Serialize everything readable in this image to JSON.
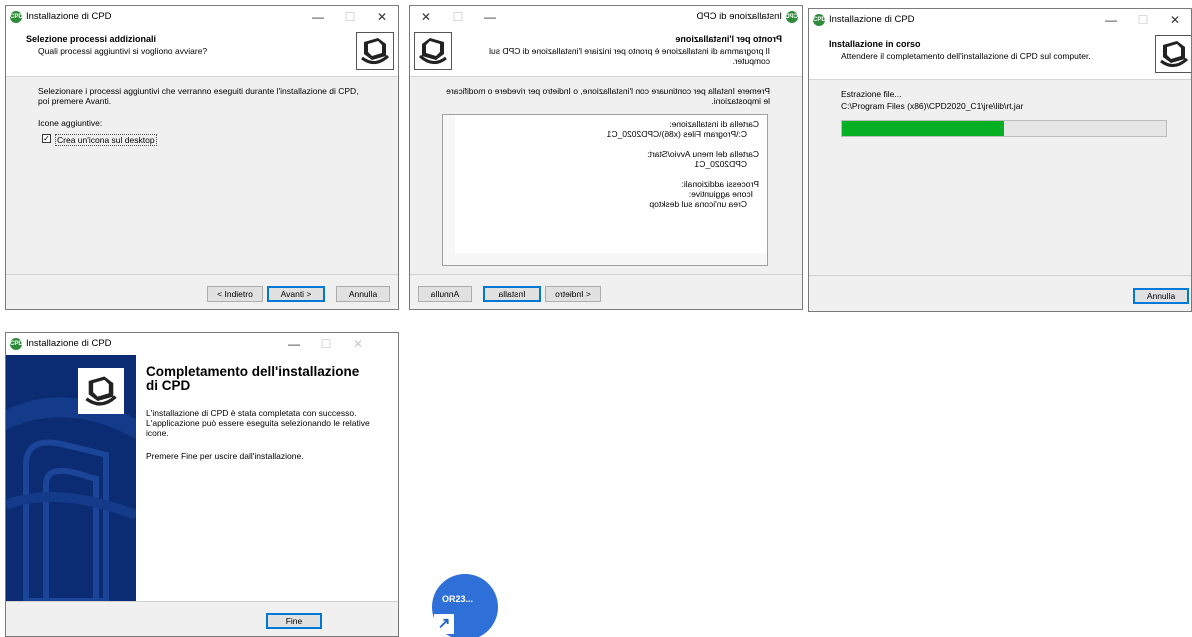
{
  "app_icon_text": "CPD",
  "window_title": "Installazione di CPD",
  "minimize": "—",
  "maximize": "☐",
  "close": "✕",
  "w1": {
    "header_title": "Selezione processi addizionali",
    "header_subtitle": "Quali processi aggiuntivi si vogliono avviare?",
    "instruction_line1": "Selezionare i processi aggiuntivi che verranno eseguiti durante l'installazione di CPD,",
    "instruction_line2": "poi premere Avanti.",
    "group_label": "Icone aggiuntive:",
    "checkbox_label": "Crea un'icona sul desktop",
    "checkbox_checked": "✓",
    "back_label": "< Indietro",
    "next_label": "Avanti >",
    "cancel_label": "Annulla"
  },
  "w2": {
    "header_title": "Pronto per l'installazione",
    "header_subtitle_line1": "Il programma di installazione è pronto per iniziare l'installazione di CPD sul",
    "header_subtitle_line2": "computer.",
    "instruction_line1": "Premere Installa per continuare con l'installazione, o Indietro per rivedere o modificare",
    "instruction_line2": "le impostazioni.",
    "memo_lines": [
      "Cartella di installazione:",
      "C:\\Program Files (x86)\\CPD2020_C1",
      "",
      "Cartella del menu Avvio/Start:",
      "CPD2020_C1",
      "",
      "Processi addizionali:",
      "Icone aggiuntive:",
      "Crea un'icona sul desktop"
    ],
    "cancel_label": "Annulla",
    "install_label": "Installa",
    "back_label": "< Indietro"
  },
  "w3": {
    "header_title": "Installazione in corso",
    "header_subtitle": "Attendere il completamento dell'installazione di CPD sul computer.",
    "status_label": "Estrazione file...",
    "current_file": "C:\\Program Files (x86)\\CPD2020_C1\\jre\\lib\\rt.jar",
    "progress_percent": 50,
    "cancel_label": "Annulla"
  },
  "w4": {
    "heading_line1": "Completamento dell'installazione",
    "heading_line2": "di CPD",
    "text_line1": "L'installazione di CPD è stata completata con successo.",
    "text_line2": "L'applicazione può essere eseguita selezionando le relative",
    "text_line3": "icone.",
    "text_line4": "Premere Fine per uscire dall'installazione.",
    "finish_label": "Fine"
  },
  "desktop_shortcut": {
    "label": "OR23...",
    "arrow": "↗",
    "color": "#2f6fd8"
  }
}
